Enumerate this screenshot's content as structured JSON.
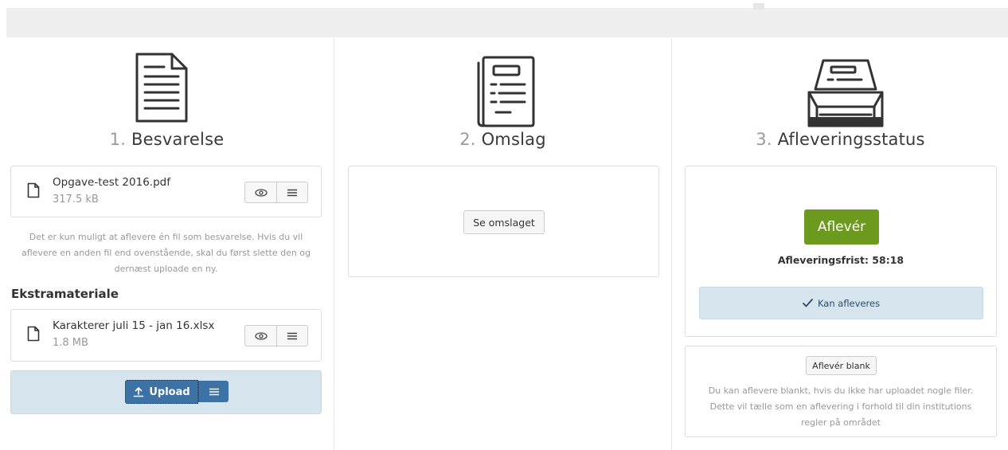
{
  "section1": {
    "number": "1.",
    "title": "Besvarelse",
    "file": {
      "name": "Opgave-test 2016.pdf",
      "size": "317.5 kB"
    },
    "note": "Det er kun muligt at aflevere én fil som besvarelse. Hvis du vil aflevere en anden fil end ovenstående, skal du først slette den og dernæst uploade en ny.",
    "extra_heading": "Ekstramateriale",
    "extra_file": {
      "name": "Karakterer juli 15 - jan 16.xlsx",
      "size": "1.8 MB"
    },
    "upload_label": "Upload"
  },
  "section2": {
    "number": "2.",
    "title": "Omslag",
    "button_label": "Se omslaget"
  },
  "section3": {
    "number": "3.",
    "title": "Afleveringsstatus",
    "submit_label": "Aflevér",
    "deadline": "Afleveringsfrist: 58:18",
    "status": "Kan afleveres",
    "blank_label": "Aflevér blank",
    "blank_note": "Du kan aflevere blankt, hvis du ikke har uploadet nogle filer. Dette vil tælle som en aflevering i forhold til din institutions regler på området"
  },
  "colors": {
    "accent_blue": "#3d72a4",
    "submit_green": "#6c9a1e",
    "info_bg": "#d6e4ee"
  },
  "icons": [
    "document-icon",
    "cover-icon",
    "filing-tray-icon",
    "file-icon",
    "eye-icon",
    "menu-icon",
    "upload-icon",
    "check-icon"
  ]
}
